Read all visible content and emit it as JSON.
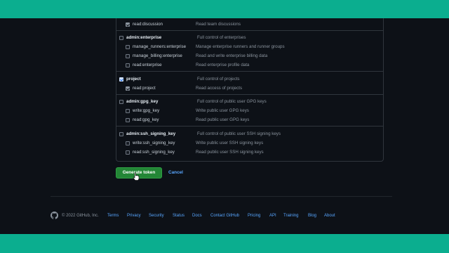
{
  "scopes": [
    {
      "name": "read:discussion",
      "desc": "Read team discussions",
      "checked": true,
      "level": "child"
    },
    {
      "name": "admin:enterprise",
      "desc": "Full control of enterprises",
      "checked": false,
      "level": "parent"
    },
    {
      "name": "manage_runners:enterprise",
      "desc": "Manage enterprise runners and runner groups",
      "checked": false,
      "level": "child"
    },
    {
      "name": "manage_billing:enterprise",
      "desc": "Read and write enterprise billing data",
      "checked": false,
      "level": "child"
    },
    {
      "name": "read:enterprise",
      "desc": "Read enterprise profile data",
      "checked": false,
      "level": "child"
    },
    {
      "name": "project",
      "desc": "Full control of projects",
      "checked": true,
      "level": "parent"
    },
    {
      "name": "read:project",
      "desc": "Read access of projects",
      "checked": true,
      "level": "child"
    },
    {
      "name": "admin:gpg_key",
      "desc": "Full control of public user GPG keys",
      "checked": false,
      "level": "parent"
    },
    {
      "name": "write:gpg_key",
      "desc": "Write public user GPG keys",
      "checked": false,
      "level": "child"
    },
    {
      "name": "read:gpg_key",
      "desc": "Read public user GPG keys",
      "checked": false,
      "level": "child"
    },
    {
      "name": "admin:ssh_signing_key",
      "desc": "Full control of public user SSH signing keys",
      "checked": false,
      "level": "parent"
    },
    {
      "name": "write:ssh_signing_key",
      "desc": "Write public user SSH signing keys",
      "checked": false,
      "level": "child"
    },
    {
      "name": "read:ssh_signing_key",
      "desc": "Read public user SSH signing keys",
      "checked": false,
      "level": "child"
    }
  ],
  "actions": {
    "generate_label": "Generate token",
    "cancel_label": "Cancel"
  },
  "footer": {
    "copyright": "© 2022 GitHub, Inc.",
    "links": [
      "Terms",
      "Privacy",
      "Security",
      "Status",
      "Docs",
      "Contact GitHub",
      "Pricing",
      "API",
      "Training",
      "Blog",
      "About"
    ]
  },
  "colors": {
    "accent_band": "#0bae8f",
    "primary_button": "#238636",
    "link": "#58a6ff",
    "background": "#0d1117"
  },
  "icons": {
    "logo": "github-mark-icon",
    "cursor": "hand-pointer-icon"
  }
}
